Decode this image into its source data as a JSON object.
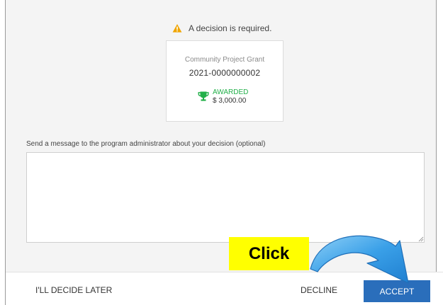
{
  "dialog": {
    "warning": {
      "icon": "warning-triangle-icon",
      "text": "A decision is required.",
      "icon_color": "#f0a500"
    },
    "grant": {
      "name": "Community Project Grant",
      "number": "2021-0000000002",
      "status": "AWARDED",
      "amount": "$ 3,000.00",
      "status_icon": "trophy-icon",
      "status_color": "#23b04a"
    },
    "message": {
      "label": "Send a message to the program administrator about your decision (optional)",
      "value": "",
      "placeholder": ""
    }
  },
  "footer": {
    "decide_later_label": "I'LL DECIDE LATER",
    "decline_label": "DECLINE",
    "accept_label": "ACCEPT",
    "accept_color": "#2a6ebb"
  },
  "annotation": {
    "callout_text": "Click",
    "callout_color": "#ffff00",
    "arrow_icon": "curved-arrow-icon",
    "arrow_color": "#3aa0e8"
  }
}
